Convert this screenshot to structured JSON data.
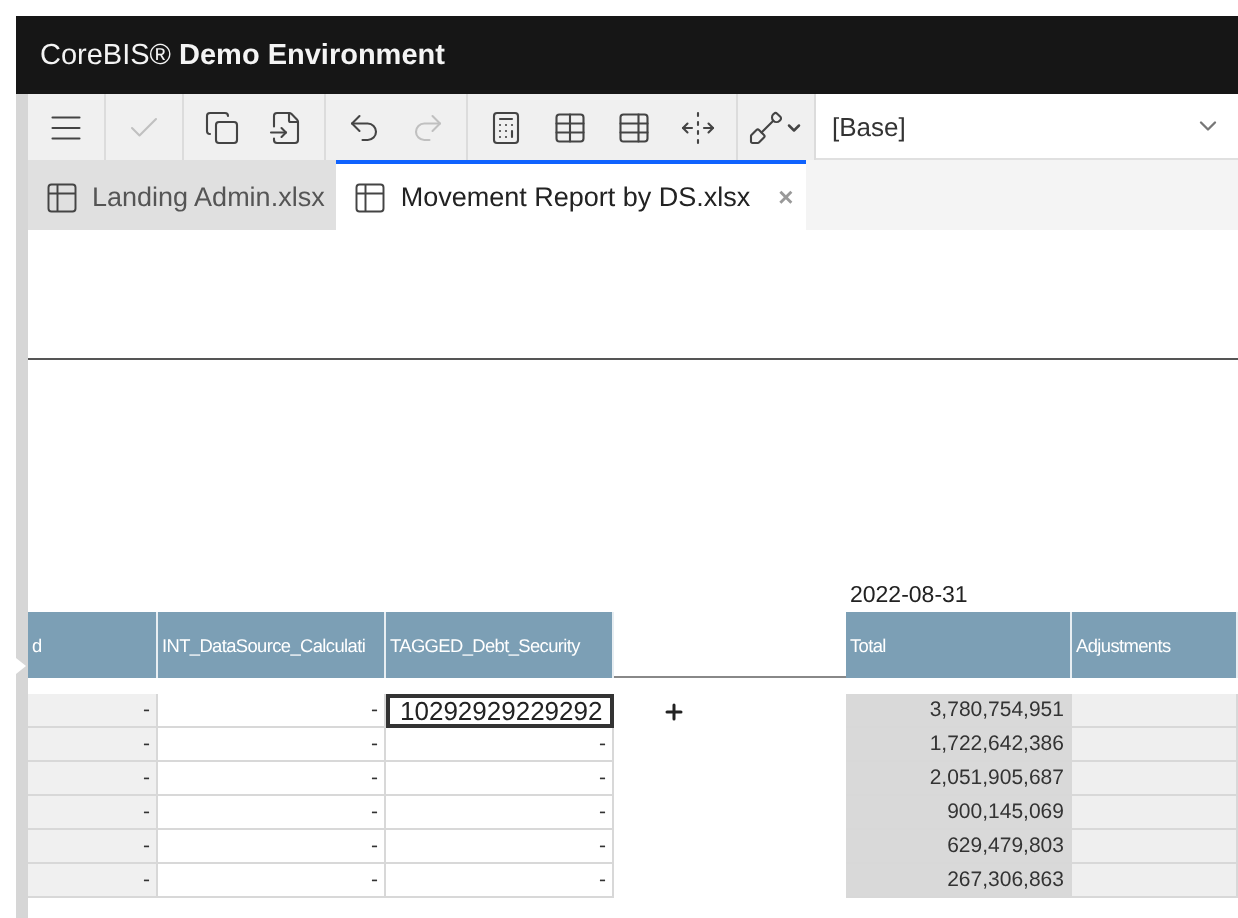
{
  "header": {
    "title": "CoreBIS® **Demo Environment**"
  },
  "toolbar": {
    "groups": [
      [
        {
          "kind": "menu",
          "disabled": false
        }
      ],
      [
        {
          "kind": "check",
          "disabled": true
        }
      ],
      [
        {
          "kind": "copy",
          "disabled": false
        },
        {
          "kind": "paste",
          "disabled": false
        }
      ],
      [
        {
          "kind": "undo",
          "disabled": false
        },
        {
          "kind": "redo",
          "disabled": true
        }
      ],
      [
        {
          "kind": "calc",
          "disabled": false
        },
        {
          "kind": "table",
          "disabled": false
        },
        {
          "kind": "tables",
          "disabled": false
        },
        {
          "kind": "resize",
          "disabled": false
        }
      ],
      [
        {
          "kind": "shovel",
          "disabled": false
        }
      ]
    ],
    "dropdown": {
      "value": "[Base]"
    }
  },
  "tabs": [
    {
      "label": "Landing Admin.xlsx",
      "selected": false
    },
    {
      "label": "Movement Report by DS.xlsx",
      "selected": true,
      "close": "×"
    }
  ],
  "sheet": {
    "date": "2022-08-31",
    "columns": [
      "d",
      "INT_DataSource_Calculati",
      "TAGGED_Debt_Security",
      "Total",
      "Adjustments"
    ],
    "rows": [
      {
        "c1": "-",
        "c2": "-",
        "c3": "10292929229292",
        "total": "3,780,754,951",
        "editing": true
      },
      {
        "c1": "-",
        "c2": "-",
        "c3": "-",
        "total": "1,722,642,386",
        "editing": false
      },
      {
        "c1": "-",
        "c2": "-",
        "c3": "-",
        "total": "2,051,905,687",
        "editing": false
      },
      {
        "c1": "-",
        "c2": "-",
        "c3": "-",
        "total": "900,145,069",
        "editing": false
      },
      {
        "c1": "-",
        "c2": "-",
        "c3": "-",
        "total": "629,479,803",
        "editing": false
      },
      {
        "c1": "-",
        "c2": "-",
        "c3": "-",
        "total": "267,306,863",
        "editing": false
      }
    ]
  }
}
